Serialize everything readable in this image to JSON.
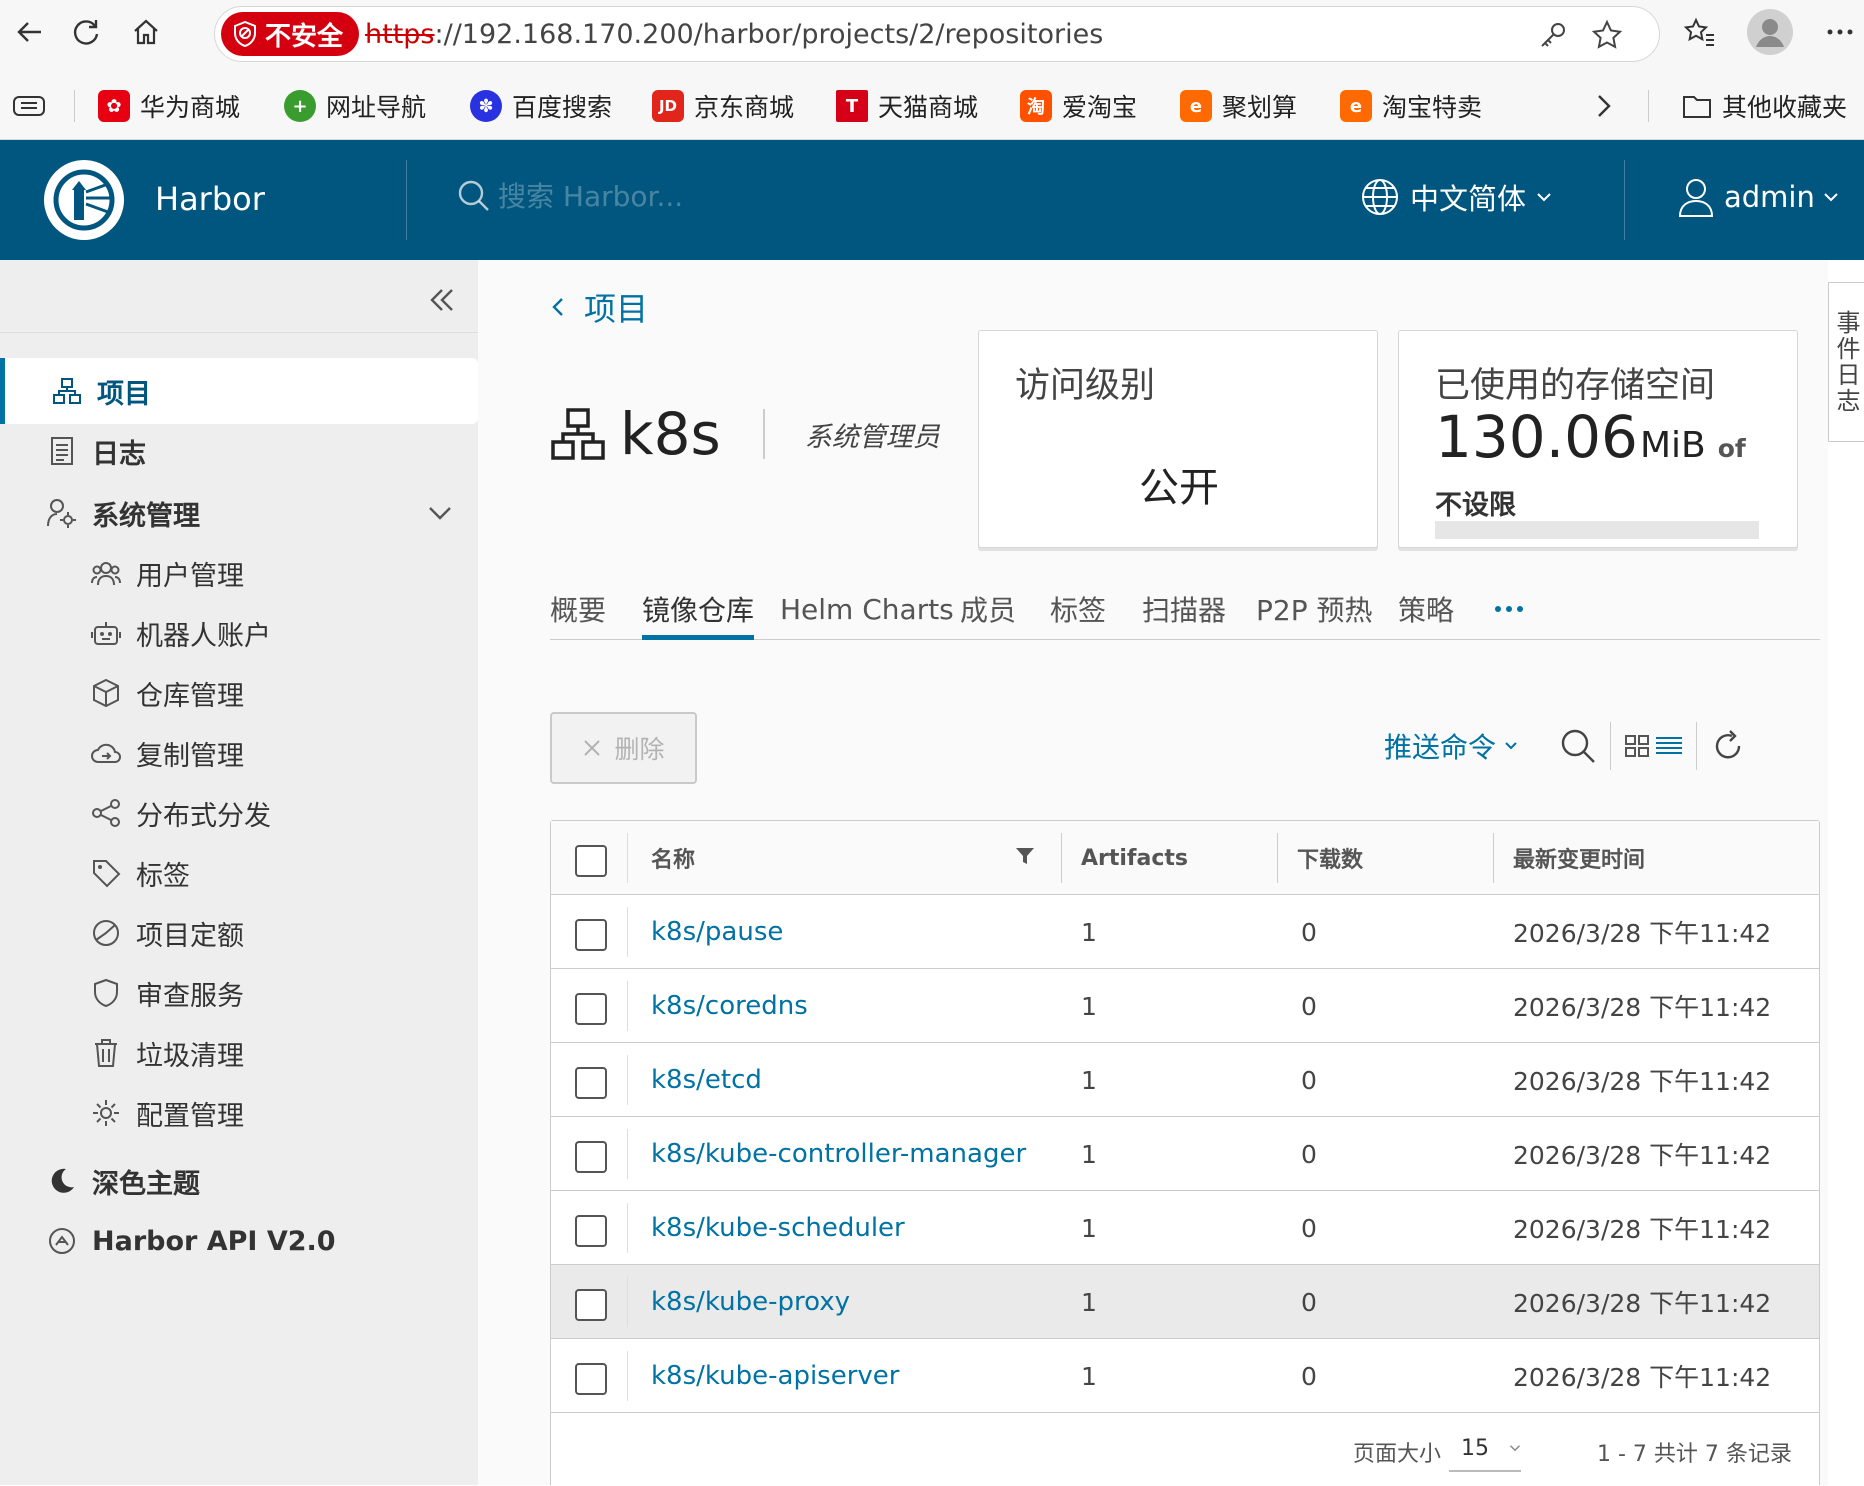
{
  "browser": {
    "security_label": "不安全",
    "url_scheme": "https",
    "url_rest": "://192.168.170.200/harbor/projects/2/repositories",
    "bookmarks": [
      "华为商城",
      "网址导航",
      "百度搜索",
      "京东商城",
      "天猫商城",
      "爱淘宝",
      "聚划算",
      "淘宝特卖"
    ],
    "other_bookmarks": "其他收藏夹"
  },
  "header": {
    "brand": "Harbor",
    "search_placeholder": "搜索 Harbor...",
    "language": "中文简体",
    "user": "admin"
  },
  "sidebar": {
    "items": {
      "projects": "项目",
      "logs": "日志",
      "admin": "系统管理",
      "users": "用户管理",
      "robots": "机器人账户",
      "registries": "仓库管理",
      "replication": "复制管理",
      "distribution": "分布式分发",
      "labels": "标签",
      "quotas": "项目定额",
      "interrogation": "审查服务",
      "gc": "垃圾清理",
      "config": "配置管理"
    },
    "dark_theme": "深色主题",
    "api": "Harbor API V2.0"
  },
  "event_log": "事件日志",
  "project": {
    "back_label": "项目",
    "name": "k8s",
    "role": "系统管理员",
    "access_title": "访问级别",
    "access_value": "公开",
    "storage_title": "已使用的存储空间",
    "storage_value": "130.06",
    "storage_unit": "MiB",
    "storage_of": "of",
    "storage_limit": "不设限",
    "storage_fill_percent": 0
  },
  "tabs": [
    "概要",
    "镜像仓库",
    "Helm Charts",
    "成员",
    "标签",
    "扫描器",
    "P2P 预热",
    "策略"
  ],
  "active_tab": "镜像仓库",
  "toolbar": {
    "delete": "删除",
    "push_command": "推送命令"
  },
  "table": {
    "columns": [
      "名称",
      "Artifacts",
      "下载数",
      "最新变更时间"
    ],
    "rows": [
      {
        "name": "k8s/pause",
        "artifacts": "1",
        "downloads": "0",
        "updated": "2026/3/28 下午11:42"
      },
      {
        "name": "k8s/coredns",
        "artifacts": "1",
        "downloads": "0",
        "updated": "2026/3/28 下午11:42"
      },
      {
        "name": "k8s/etcd",
        "artifacts": "1",
        "downloads": "0",
        "updated": "2026/3/28 下午11:42"
      },
      {
        "name": "k8s/kube-controller-manager",
        "artifacts": "1",
        "downloads": "0",
        "updated": "2026/3/28 下午11:42"
      },
      {
        "name": "k8s/kube-scheduler",
        "artifacts": "1",
        "downloads": "0",
        "updated": "2026/3/28 下午11:42"
      },
      {
        "name": "k8s/kube-proxy",
        "artifacts": "1",
        "downloads": "0",
        "updated": "2026/3/28 下午11:42"
      },
      {
        "name": "k8s/kube-apiserver",
        "artifacts": "1",
        "downloads": "0",
        "updated": "2026/3/28 下午11:42"
      }
    ],
    "page_size_label": "页面大小",
    "page_size": "15",
    "page_info": "1 - 7 共计 7 条记录"
  },
  "colors": {
    "header_bg": "#00567e",
    "accent": "#0072a3",
    "insecure": "#d4000f"
  }
}
